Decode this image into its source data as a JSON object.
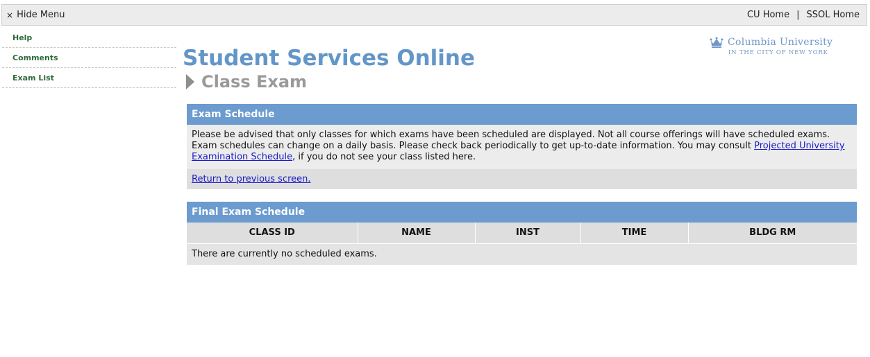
{
  "topbar": {
    "hide_menu_icon": "×",
    "hide_menu_label": "Hide Menu",
    "links": [
      "CU Home",
      "SSOL Home"
    ],
    "separator": "|"
  },
  "sidebar": {
    "items": [
      {
        "label": "Help"
      },
      {
        "label": "Comments"
      },
      {
        "label": "Exam List"
      }
    ]
  },
  "logo": {
    "icon": "crown-icon",
    "name": "Columbia University",
    "subtitle": "IN THE CITY OF NEW YORK"
  },
  "site_title": "Student Services Online",
  "page_title": "Class Exam",
  "exam_schedule": {
    "header": "Exam Schedule",
    "body_text_1": "Please be advised that only classes for which exams have been scheduled are displayed. Not all course offerings will have scheduled exams. Exam schedules can change on a daily basis. Please check back periodically to get up-to-date information. You may consult ",
    "body_link": "Projected University Examination Schedule",
    "body_text_2": ", if you do not see your class listed here.",
    "return_link": "Return to previous screen."
  },
  "final_exam": {
    "header": "Final Exam Schedule",
    "columns": [
      "CLASS ID",
      "NAME",
      "INST",
      "TIME",
      "BLDG RM"
    ],
    "empty_message": "There are currently no scheduled exams."
  },
  "colors": {
    "title_blue": "#6396c8",
    "header_blue": "#6b9bcf",
    "sidebar_green": "#2d6a3a",
    "link_blue": "#1a1acc"
  }
}
